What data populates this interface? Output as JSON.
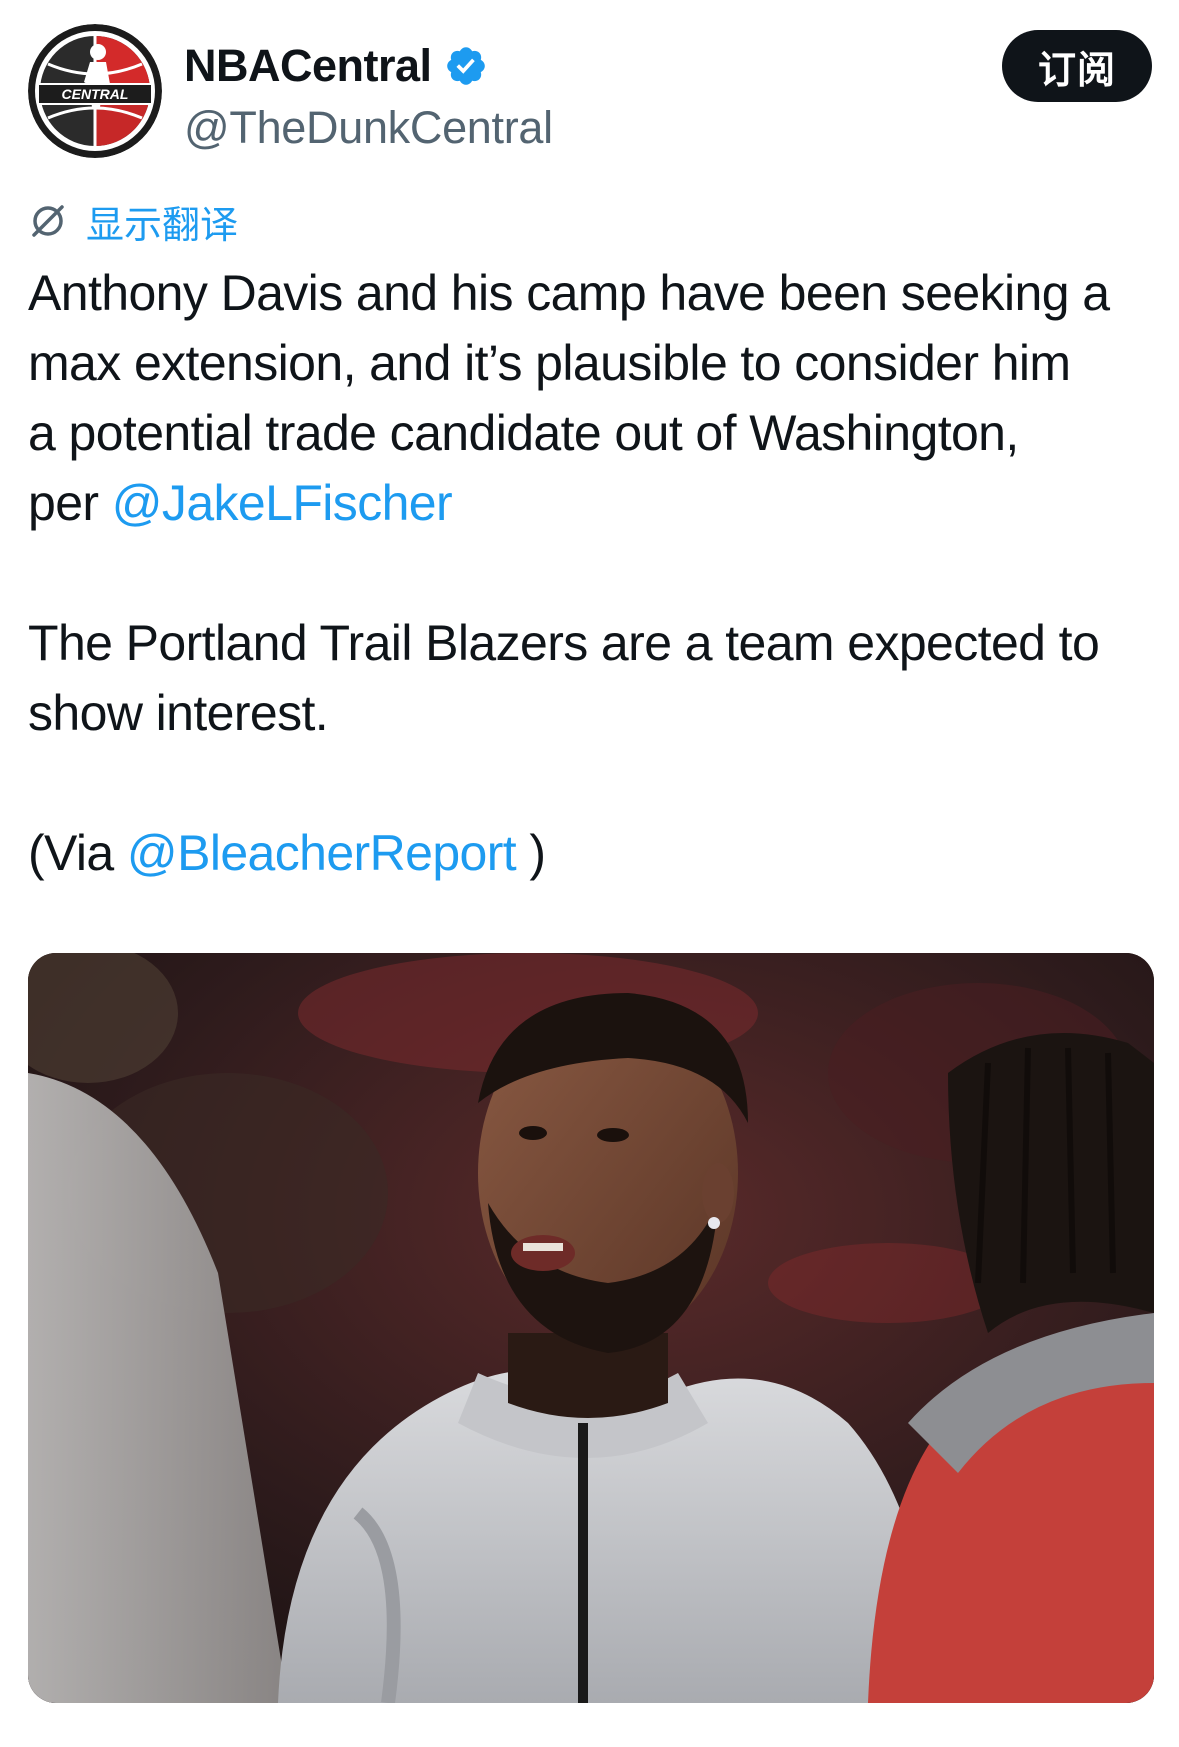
{
  "account": {
    "display_name": "NBACentral",
    "handle": "@TheDunkCentral",
    "verified": true,
    "avatar_text": "CENTRAL"
  },
  "actions": {
    "subscribe_label": "订阅"
  },
  "translate": {
    "label": "显示翻译",
    "icon": "translate-icon"
  },
  "tweet": {
    "line1": "Anthony Davis and his camp have been seeking a",
    "line2": "max extension, and it’s plausible to consider him",
    "line3": "a potential trade candidate out of Washington,",
    "line4_prefix": "per ",
    "mention_fischer": "@JakeLFischer",
    "line5": "The Portland Trail Blazers are a team expected to",
    "line6": "show interest.",
    "via_prefix": "(Via ",
    "mention_br": "@BleacherReport",
    "via_suffix": " )"
  },
  "colors": {
    "text": "#0f1419",
    "secondary": "#536471",
    "accent": "#1d9bf0",
    "button": "#0f1419"
  }
}
